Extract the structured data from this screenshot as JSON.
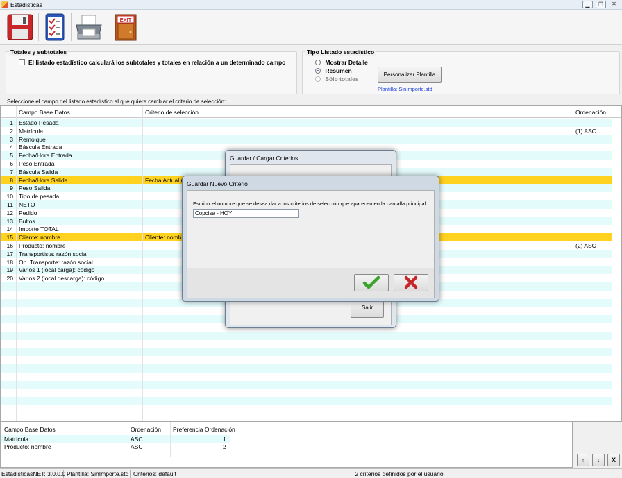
{
  "window": {
    "title": "Estadísticas",
    "controls": [
      "minimize",
      "restore",
      "close"
    ]
  },
  "toolbar": {
    "buttons": [
      "save-icon",
      "checklist-icon",
      "printer-icon",
      "exit-door-icon"
    ],
    "exit_label": "EXIT"
  },
  "totals": {
    "legend": "Totales y subtotales",
    "checkbox_label": "El listado estadístico calculará los subtotales y totales en relación a un determinado campo",
    "checked": false
  },
  "listing": {
    "legend": "Tipo Listado estadístico",
    "options": [
      {
        "label": "Mostrar Detalle",
        "selected": false,
        "enabled": true
      },
      {
        "label": "Resumen",
        "selected": true,
        "enabled": true
      },
      {
        "label": "Sólo totales",
        "selected": false,
        "enabled": false
      }
    ],
    "customize_button": "Personalizar Plantilla",
    "template_text": "Plantilla: SinImporte.std"
  },
  "instructions": "Seleccione el campo del listado estadístico al que quiere cambiar el criterio de selección:",
  "fields_grid": {
    "columns": [
      "Campo Base Datos",
      "Criterio de selección",
      "Ordenación"
    ],
    "rows": [
      {
        "n": "1",
        "field": "Estado Pesada",
        "criteria": "",
        "order": "",
        "highlight": false
      },
      {
        "n": "2",
        "field": "Matrícula",
        "criteria": "",
        "order": "(1) ASC",
        "highlight": false
      },
      {
        "n": "3",
        "field": "Remolque",
        "criteria": "",
        "order": "",
        "highlight": false
      },
      {
        "n": "4",
        "field": "Báscula Entrada",
        "criteria": "",
        "order": "",
        "highlight": false
      },
      {
        "n": "5",
        "field": "Fecha/Hora Entrada",
        "criteria": "",
        "order": "",
        "highlight": false
      },
      {
        "n": "6",
        "field": "Peso Entrada",
        "criteria": "",
        "order": "",
        "highlight": false
      },
      {
        "n": "7",
        "field": "Báscula Salida",
        "criteria": "",
        "order": "",
        "highlight": false
      },
      {
        "n": "8",
        "field": "Fecha/Hora Salida",
        "criteria": "Fecha Actual (2",
        "order": "",
        "highlight": true
      },
      {
        "n": "9",
        "field": "Peso Salida",
        "criteria": "",
        "order": "",
        "highlight": false
      },
      {
        "n": "10",
        "field": "Tipo de pesada",
        "criteria": "",
        "order": "",
        "highlight": false
      },
      {
        "n": "11",
        "field": "NETO",
        "criteria": "",
        "order": "",
        "highlight": false
      },
      {
        "n": "12",
        "field": "Pedido",
        "criteria": "",
        "order": "",
        "highlight": false
      },
      {
        "n": "13",
        "field": "Bultos",
        "criteria": "",
        "order": "",
        "highlight": false
      },
      {
        "n": "14",
        "field": "Importe TOTAL",
        "criteria": "",
        "order": "",
        "highlight": false
      },
      {
        "n": "15",
        "field": "Cliente: nombre",
        "criteria": "Cliente: nombre i",
        "order": "",
        "highlight": true
      },
      {
        "n": "16",
        "field": "Producto: nombre",
        "criteria": "",
        "order": "(2) ASC",
        "highlight": false
      },
      {
        "n": "17",
        "field": "Transportista: razón social",
        "criteria": "",
        "order": "",
        "highlight": false
      },
      {
        "n": "18",
        "field": "Op. Transporte: razón social",
        "criteria": "",
        "order": "",
        "highlight": false
      },
      {
        "n": "19",
        "field": "Varios 1 (local carga): código",
        "criteria": "",
        "order": "",
        "highlight": false
      },
      {
        "n": "20",
        "field": "Varios 2 (local descarga): código",
        "criteria": "",
        "order": "",
        "highlight": false
      }
    ]
  },
  "load_dialog": {
    "title": "Guardar / Cargar Criterios",
    "exit_button": "Salir"
  },
  "new_dialog": {
    "title": "Guardar Nuevo Criterio",
    "prompt": "Escribir el nombre que se desea dar a los criterios de selección que aparecen en la pantalla principal:",
    "name_value": "Copcisa - HOY",
    "ok_icon": "checkmark-icon",
    "cancel_icon": "cross-icon"
  },
  "order_grid": {
    "columns": [
      "Campo Base Datos",
      "Ordenación",
      "Preferencia Ordenación"
    ],
    "rows": [
      {
        "field": "Matrícula",
        "order": "ASC",
        "pref": "1"
      },
      {
        "field": "Producto: nombre",
        "order": "ASC",
        "pref": "2"
      }
    ]
  },
  "order_buttons": {
    "up": "↑",
    "down": "↓",
    "remove": "X"
  },
  "statusbar": {
    "version": "EstadisticasNET: 3.0.0.0",
    "template": "Plantilla: SinImporte.std",
    "criteria": "Criterios: default",
    "count": "2 criterios definidos por el usuario"
  },
  "colors": {
    "row_alt": "#e4fbfc",
    "highlight": "#ffd21f",
    "link_blue": "#1a3cd8",
    "red_icon": "#c7262b",
    "green_icon": "#3aa52c"
  }
}
